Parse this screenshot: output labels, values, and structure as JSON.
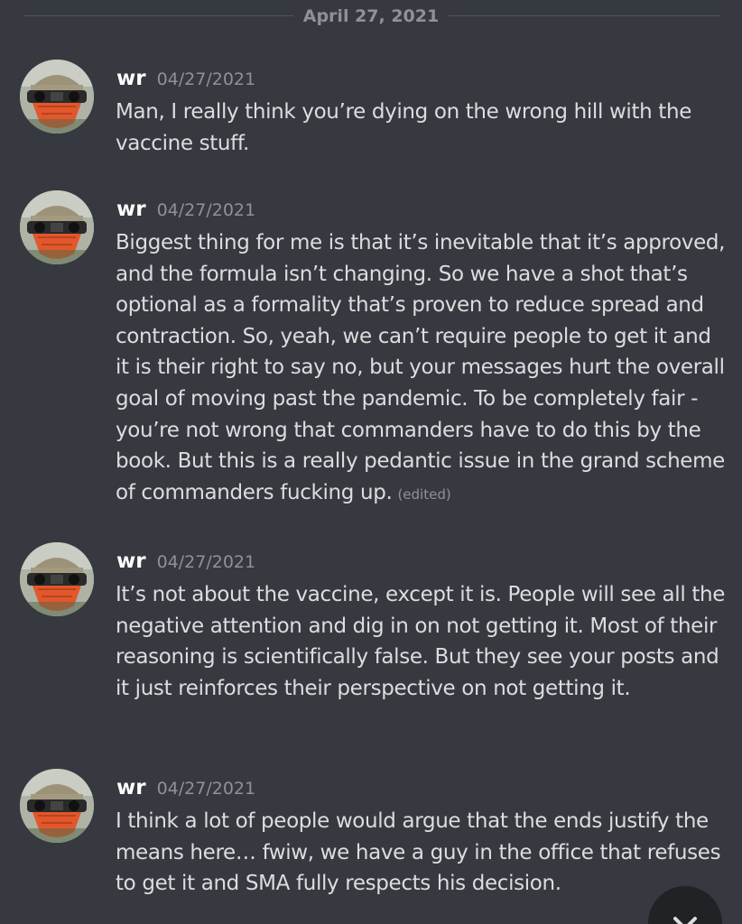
{
  "divider": {
    "date": "April 27, 2021"
  },
  "messages": [
    {
      "username": "wr",
      "timestamp": "04/27/2021",
      "text": "Man, I really think you’re dying on the wrong hill with the vaccine stuff.",
      "edited": ""
    },
    {
      "username": "wr",
      "timestamp": "04/27/2021",
      "text": "Biggest thing for me is that it’s inevitable that it’s approved, and the formula isn’t changing. So we have a shot that’s optional as a formality that’s proven to reduce spread and contraction. So, yeah, we can’t require people to get it and it is their right to say no, but your messages hurt the overall goal of moving past the pandemic. To be completely fair - you’re not wrong that commanders have to do this by the book. But this is a really pedantic issue in the grand scheme of commanders fucking up.",
      "edited": "(edited)"
    },
    {
      "username": "wr",
      "timestamp": "04/27/2021",
      "text": "It’s not about the vaccine, except it is. People will see all the negative attention and dig in on not getting it. Most of their reasoning is scientifically false. But they see your posts and it just reinforces their perspective on not getting it.",
      "edited": ""
    },
    {
      "username": "wr",
      "timestamp": "04/27/2021",
      "text": "I think a lot of people would argue that the ends justify the means here… fwiw, we have a guy in the office that refuses to get it and SMA fully respects his decision.",
      "edited": ""
    }
  ],
  "icons": {
    "avatar": "avatar-soldier-icon",
    "close": "close-icon"
  },
  "colors": {
    "background": "#36393f",
    "text": "#dcddde",
    "muted": "#8e9297",
    "username": "#ffffff",
    "fab": "#202225"
  }
}
